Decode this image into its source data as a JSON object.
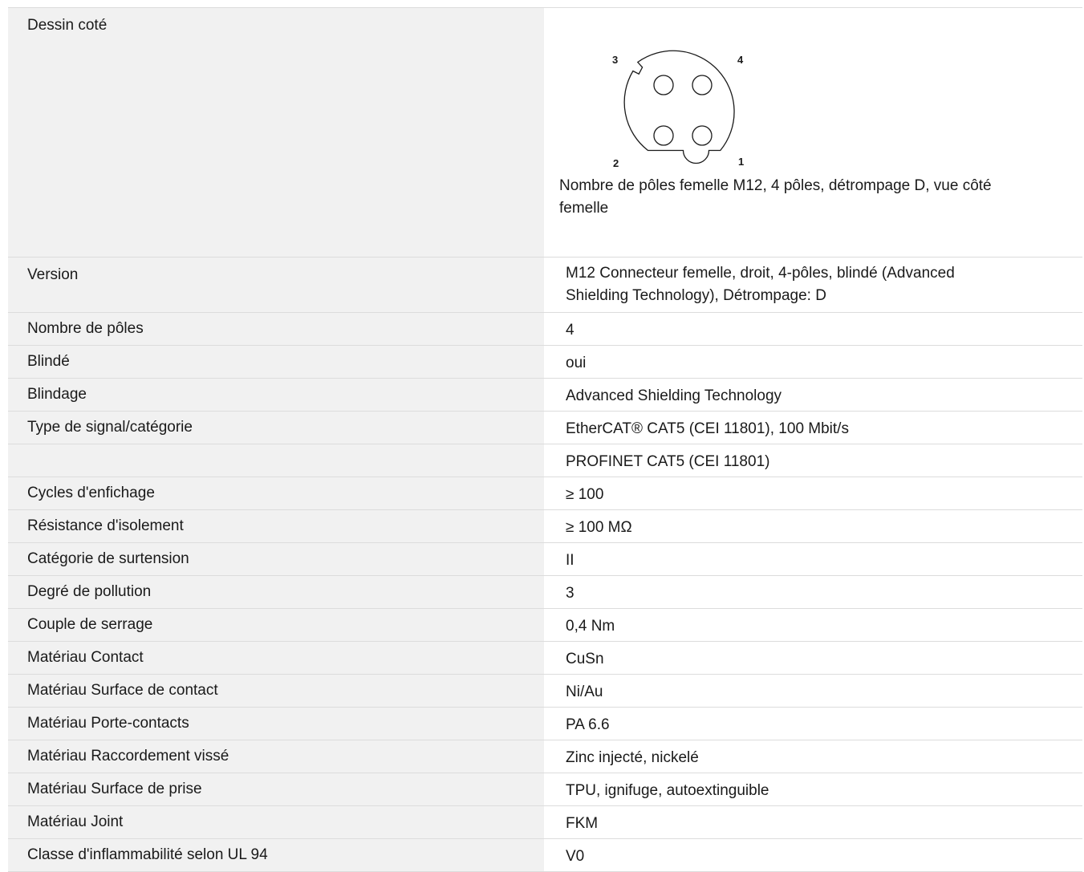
{
  "drawing_row": {
    "label": "Dessin coté",
    "pin_labels": [
      "3",
      "4",
      "2",
      "1"
    ],
    "caption": "Nombre de pôles femelle M12, 4 pôles, détrompage D, vue côté femelle"
  },
  "version_row": {
    "label": "Version",
    "value": "M12 Connecteur femelle, droit, 4-pôles, blindé (Advanced Shielding Technology), Détrompage: D"
  },
  "rows": [
    {
      "label": "Nombre de pôles",
      "value": "4"
    },
    {
      "label": "Blindé",
      "value": "oui"
    },
    {
      "label": "Blindage",
      "value": "Advanced Shielding Technology"
    },
    {
      "label": "Type de signal/catégorie",
      "value": "EtherCAT® CAT5 (CEI 11801), 100 Mbit/s"
    },
    {
      "label": "",
      "value": "PROFINET CAT5 (CEI 11801)"
    },
    {
      "label": "Cycles d'enfichage",
      "value": "≥ 100"
    },
    {
      "label": "Résistance d'isolement",
      "value": "≥ 100 MΩ"
    },
    {
      "label": "Catégorie de surtension",
      "value": "II"
    },
    {
      "label": "Degré de pollution",
      "value": "3"
    },
    {
      "label": "Couple de serrage",
      "value": "0,4 Nm"
    },
    {
      "label": "Matériau Contact",
      "value": "CuSn"
    },
    {
      "label": "Matériau Surface de contact",
      "value": "Ni/Au"
    },
    {
      "label": "Matériau Porte-contacts",
      "value": "PA 6.6"
    },
    {
      "label": "Matériau Raccordement vissé",
      "value": "Zinc injecté, nickelé"
    },
    {
      "label": "Matériau Surface de prise",
      "value": "TPU, ignifuge, autoextinguible"
    },
    {
      "label": "Matériau Joint",
      "value": "FKM"
    },
    {
      "label": "Classe d'inflammabilité selon UL 94",
      "value": "V0"
    }
  ]
}
